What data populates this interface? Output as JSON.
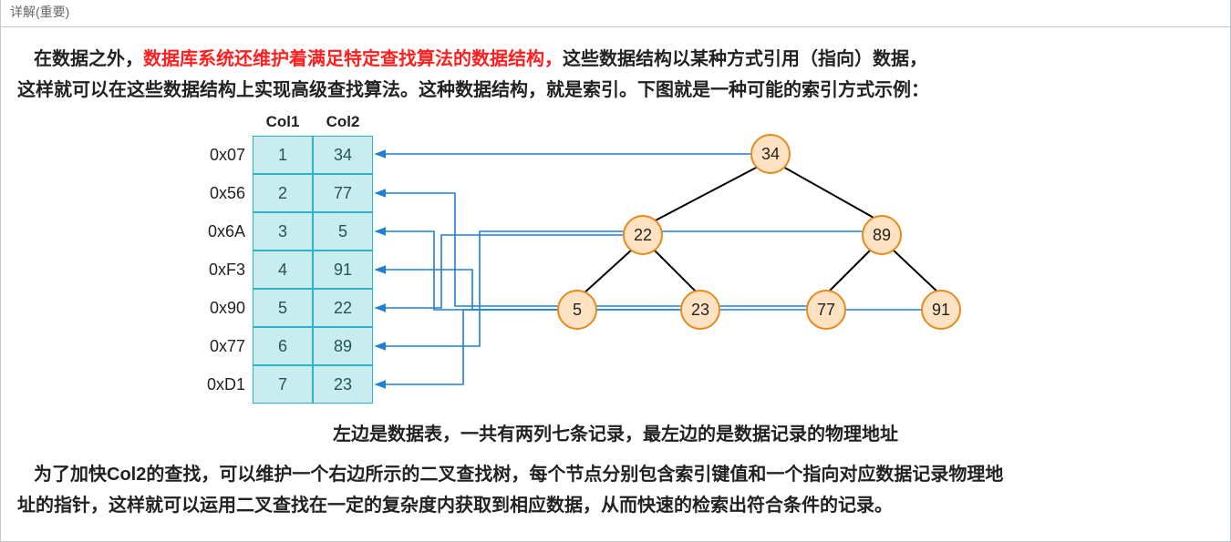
{
  "titlebar": "详解(重要)",
  "para1_pre": "在数据之外，",
  "para1_red": "数据库系统还维护着满足特定查找算法的数据结构，",
  "para1_post": "这些数据结构以某种方式引用（指向）数据，",
  "para1_line2": "这样就可以在这些数据结构上实现高级查找算法。这种数据结构，就是索引。下图就是一种可能的索引方式示例：",
  "caption": "左边是数据表，一共有两列七条记录，最左边的是数据记录的物理地址",
  "para2_l1": "为了加快Col2的查找，可以维护一个右边所示的二叉查找树，每个节点分别包含索引键值和一个指向对应数据记录物理地",
  "para2_l2": "址的指针，这样就可以运用二叉查找在一定的复杂度内获取到相应数据，从而快速的检索出符合条件的记录。",
  "table": {
    "headers": [
      "Col1",
      "Col2"
    ],
    "rows": [
      {
        "addr": "0x07",
        "c1": "1",
        "c2": "34"
      },
      {
        "addr": "0x56",
        "c1": "2",
        "c2": "77"
      },
      {
        "addr": "0x6A",
        "c1": "3",
        "c2": "5"
      },
      {
        "addr": "0xF3",
        "c1": "4",
        "c2": "91"
      },
      {
        "addr": "0x90",
        "c1": "5",
        "c2": "22"
      },
      {
        "addr": "0x77",
        "c1": "6",
        "c2": "89"
      },
      {
        "addr": "0xD1",
        "c1": "7",
        "c2": "23"
      }
    ]
  },
  "tree": {
    "root": "34",
    "l": "22",
    "r": "89",
    "ll": "5",
    "lr": "23",
    "rl": "77",
    "rr": "91"
  },
  "chart_data": {
    "type": "table",
    "title": "索引示例：数据表与二叉查找树",
    "columns": [
      "物理地址",
      "Col1",
      "Col2"
    ],
    "rows": [
      [
        "0x07",
        1,
        34
      ],
      [
        "0x56",
        2,
        77
      ],
      [
        "0x6A",
        3,
        5
      ],
      [
        "0xF3",
        4,
        91
      ],
      [
        "0x90",
        5,
        22
      ],
      [
        "0x77",
        6,
        89
      ],
      [
        "0xD1",
        7,
        23
      ]
    ],
    "index_tree_on": "Col2",
    "index_tree": {
      "value": 34,
      "left": {
        "value": 22,
        "left": {
          "value": 5
        },
        "right": {
          "value": 23
        }
      },
      "right": {
        "value": 89,
        "left": {
          "value": 77
        },
        "right": {
          "value": 91
        }
      }
    }
  }
}
